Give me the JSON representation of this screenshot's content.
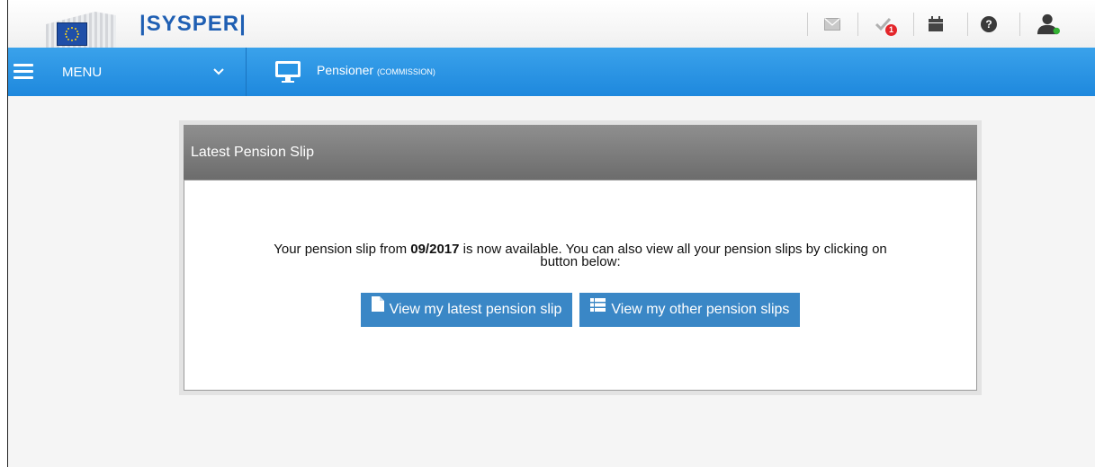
{
  "app": {
    "brand": "|SYSPER|"
  },
  "topbar": {
    "icons": [
      {
        "name": "mail-icon"
      },
      {
        "name": "tasks-check-icon",
        "badge": "1"
      },
      {
        "name": "calendar-icon"
      },
      {
        "name": "help-icon"
      },
      {
        "name": "user-icon"
      }
    ],
    "task_badge": "1"
  },
  "nav": {
    "menu_label": "MENU",
    "menu_chevron": "⌄",
    "page_title": "Pensioner",
    "page_subtitle": "(COMMISSION)"
  },
  "panel": {
    "title": "Latest Pension Slip",
    "message_prefix": "Your pension slip from ",
    "message_date": "09/2017",
    "message_suffix": " is now available. You can also view all your pension slips by clicking on",
    "message_line2": "button below:",
    "btn_latest": "View my latest pension slip",
    "btn_other": "View my other pension slips"
  },
  "colors": {
    "nav_blue": "#2a95e4",
    "button_blue": "#3a87c6",
    "panel_header": "#7d7d7d",
    "badge_red": "#e3262b"
  }
}
